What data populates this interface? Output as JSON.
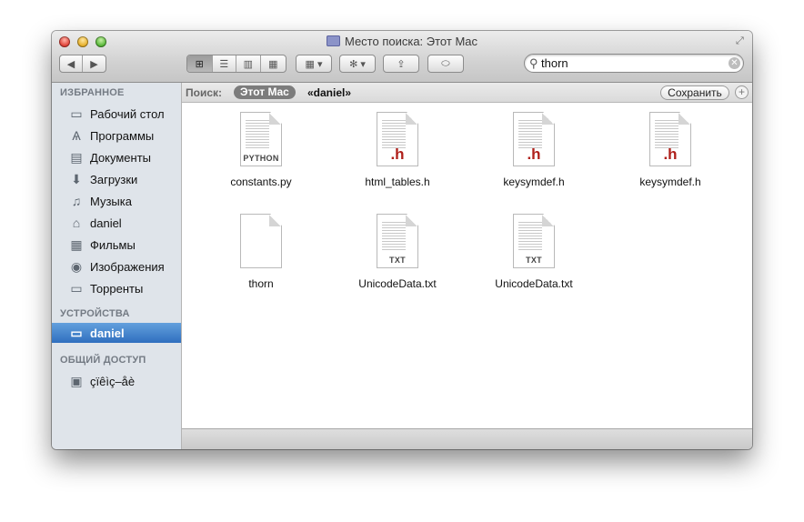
{
  "window": {
    "title": "Место поиска: Этот Mac"
  },
  "toolbar": {
    "back_label": "◀",
    "forward_label": "▶",
    "view_modes": [
      "⊞",
      "☰",
      "▥",
      "▦"
    ],
    "arrange_label": "▦ ▾",
    "action_label": "✻ ▾",
    "share_label": "⇪",
    "tags_label": "⬭"
  },
  "search": {
    "value": "thorn",
    "placeholder": ""
  },
  "sidebar": {
    "favorites_header": "ИЗБРАННОЕ",
    "favorites": [
      {
        "label": "Рабочий стол",
        "icon": "desktop-icon"
      },
      {
        "label": "Программы",
        "icon": "applications-icon"
      },
      {
        "label": "Документы",
        "icon": "documents-icon"
      },
      {
        "label": "Загрузки",
        "icon": "downloads-icon"
      },
      {
        "label": "Музыка",
        "icon": "music-icon"
      },
      {
        "label": "daniel",
        "icon": "home-icon"
      },
      {
        "label": "Фильмы",
        "icon": "movies-icon"
      },
      {
        "label": "Изображения",
        "icon": "pictures-icon"
      },
      {
        "label": "Торренты",
        "icon": "folder-icon"
      }
    ],
    "devices_header": "УСТРОЙСТВА",
    "devices": [
      {
        "label": "daniel",
        "icon": "computer-icon",
        "selected": true
      }
    ],
    "shared_header": "ОБЩИЙ ДОСТУП",
    "shared": [
      {
        "label": "çïêìç–åè",
        "icon": "network-computer-icon"
      }
    ]
  },
  "scope": {
    "label": "Поиск:",
    "this_mac": "Этот Mac",
    "user": "«daniel»",
    "save_label": "Сохранить",
    "add_label": "+"
  },
  "files": [
    {
      "name": "constants.py",
      "kind": "python",
      "tag": "PYTHON"
    },
    {
      "name": "html_tables.h",
      "kind": "header",
      "tag": ".h"
    },
    {
      "name": "keysymdef.h",
      "kind": "header",
      "tag": ".h"
    },
    {
      "name": "keysymdef.h",
      "kind": "header",
      "tag": ".h"
    },
    {
      "name": "thorn",
      "kind": "blank",
      "tag": ""
    },
    {
      "name": "UnicodeData.txt",
      "kind": "text",
      "tag": "TXT"
    },
    {
      "name": "UnicodeData.txt",
      "kind": "text",
      "tag": "TXT"
    }
  ],
  "colors": {
    "selection": "#3b7fcf",
    "header_badge": "#b0211c"
  }
}
